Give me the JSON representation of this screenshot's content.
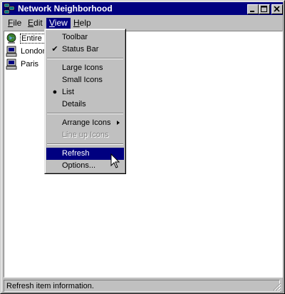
{
  "window": {
    "title": "Network Neighborhood"
  },
  "titlebar_buttons": {
    "minimize": "_",
    "maximize": "□",
    "close": "×"
  },
  "menubar": [
    {
      "label": "File",
      "accel": "F"
    },
    {
      "label": "Edit",
      "accel": "E"
    },
    {
      "label": "View",
      "accel": "V",
      "active": true
    },
    {
      "label": "Help",
      "accel": "H"
    }
  ],
  "items": [
    {
      "label": "Entire N",
      "icon": "entire-network-icon",
      "selected": true
    },
    {
      "label": "London",
      "icon": "computer-icon"
    },
    {
      "label": "Paris",
      "icon": "computer-icon"
    }
  ],
  "view_menu": {
    "toolbar": "Toolbar",
    "status_bar": "Status Bar",
    "large_icons": "Large Icons",
    "small_icons": "Small Icons",
    "list": "List",
    "details": "Details",
    "arrange_icons": "Arrange Icons",
    "line_up_icons": "Line up Icons",
    "refresh": "Refresh",
    "options": "Options...",
    "checked": "Status Bar",
    "radio_selected": "List",
    "highlighted": "Refresh"
  },
  "status": {
    "text": "Refresh item information."
  },
  "colors": {
    "titlebar": "#000080",
    "face": "#c0c0c0",
    "highlight": "#000080",
    "window_bg": "#ffffff"
  }
}
